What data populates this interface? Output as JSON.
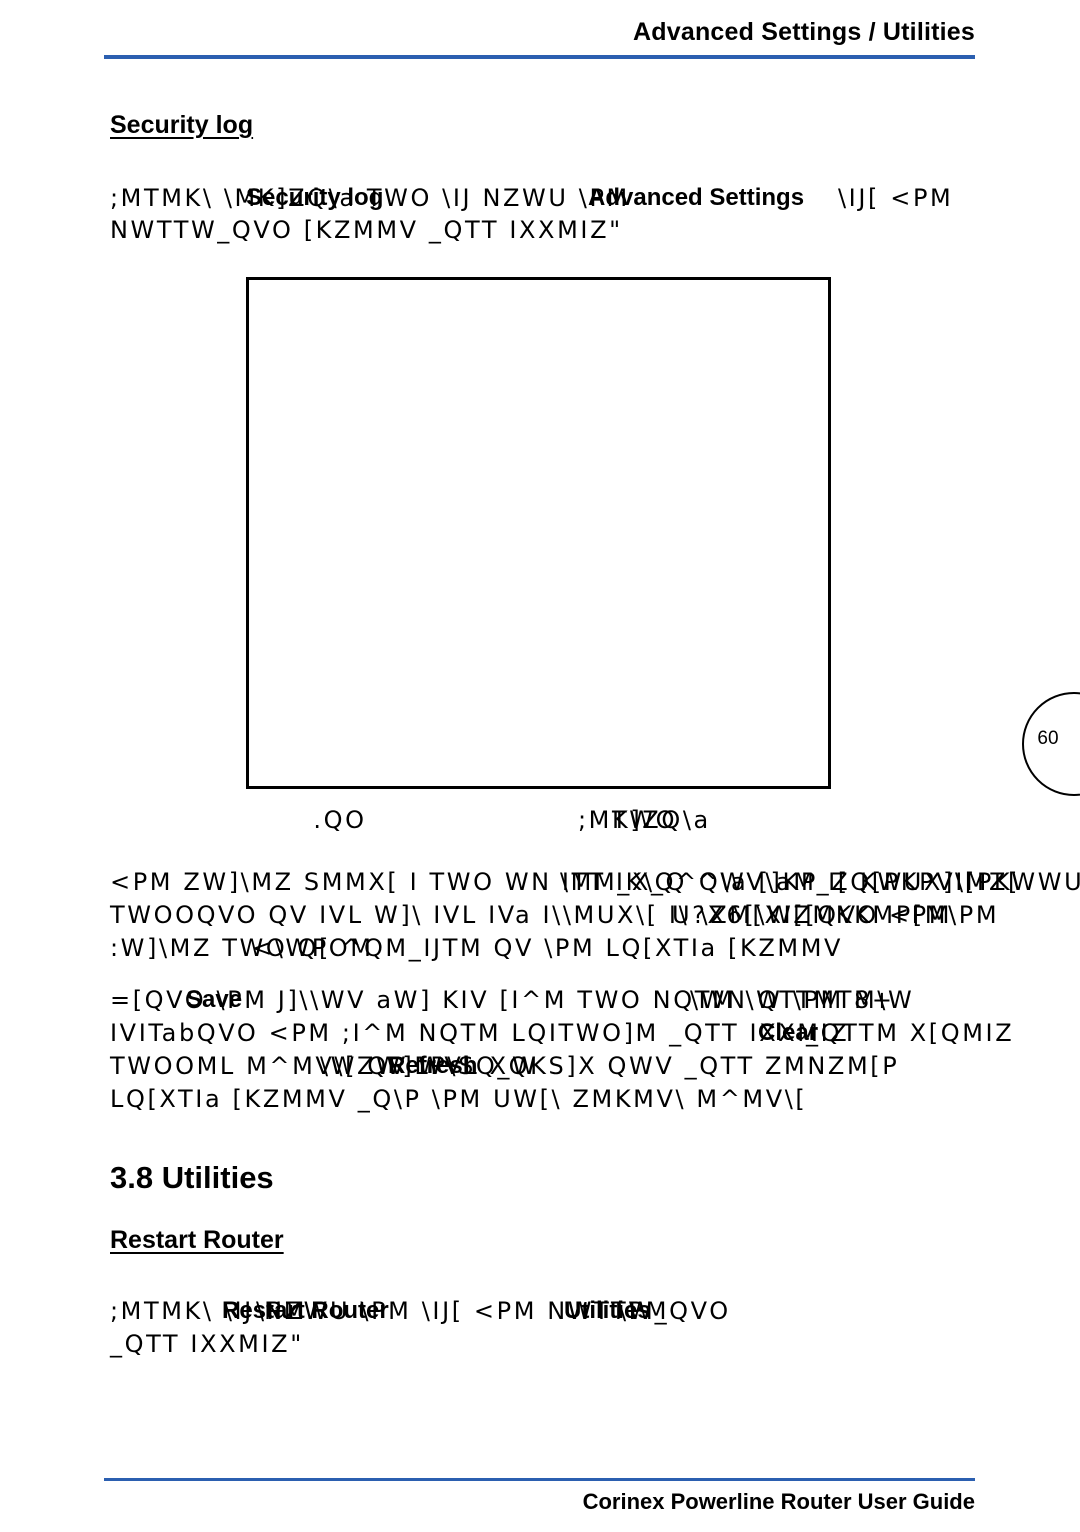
{
  "header": {
    "title": "Advanced Settings / Utilities"
  },
  "footer": {
    "title": "Corinex Powerline Router User Guide"
  },
  "page_number": "60",
  "security_log": {
    "heading": "Security log",
    "intro_line1_glyphs": ";MTMK\\ \\MK]ZQ\\a TWO \\IJ NZWU \\PM ",
    "intro_line1_bold_a": "Security log",
    "intro_line1_bold_b": "Advanced Settings",
    "intro_line1_tail_glyphs": "\\IJ[  <PM",
    "intro_line2_glyphs": "NWTTW_QVO [KZMMV _QTT IXXMIZ\""
  },
  "figure": {
    "caption_prefix_glyphs": ".QO",
    "caption_glyphs": ";MK]ZQ\\a",
    "caption_overlap_glyphs": "TWO"
  },
  "paragraph1": {
    "line1_glyphs": "<PM ZW]\\MZ SMMX[ I TWO WN ITT IK\\Q^Q\\a []KP I[ KWUX]\\MZ[",
    "line1_overprint": "\\MM_X_Q ^WV\\aM_ZQ[PKPVI[PKWWU_]\\",
    "line2_glyphs": "TWOOQVO QV IVL W]\\ IVL IVa I\\\\MUX\\[ I\\ \\ZM[XI[[QVO <PM",
    "line2_overprint": "U?X6[\\WZMKKMP[M\\PM",
    "line3_glyphs": ":W]\\MZ TWO Q[ ^QM_IJTM QV \\PM LQ[XTIa [KZMMV",
    "line3_overprint": "<\\WPOM"
  },
  "paragraph2": {
    "line1_glyphs": "=[QVO \\PM  J]\\\\WV aW] KIV [I^M TWO NQTM \\W \\PM 8+",
    "line1_bold": "Save",
    "line1_overprint": "\\WN QTTMTM\\W",
    "line2_glyphs": "IVITabQVO <PM ;I^M NQTM LQITWO]M _QTT IXXMIZ",
    "line2_bold": "Clear",
    "line2_overprint": "_QTTM X[QMIZ",
    "line3_glyphs": "TWOOML M^MV\\[ QV WVL XQKS]X QWV _QTT ZMNZM[P",
    "line3_bold": "Refresh",
    "line3_overprint": "\\WZW]LP\\SQ_W",
    "line4_glyphs": "LQ[XTIa [KZMMV _Q\\P \\PM UW[\\ ZMKMV\\ M^MV\\["
  },
  "utilities": {
    "heading": "3.8 Utilities",
    "restart_heading": "Restart Router",
    "line1_glyphs": ";MTMK\\ \\IJ NZWU \\PM \\IJ[  <PM NWTTW_QVO",
    "line1_bold_a": "Restart Router",
    "line1_bold_b": "Utilities",
    "line1_overprint_a": "\\PM",
    "line1_overprint_b": "\\PM",
    "line2_glyphs": "_QTT IXXMIZ\""
  }
}
